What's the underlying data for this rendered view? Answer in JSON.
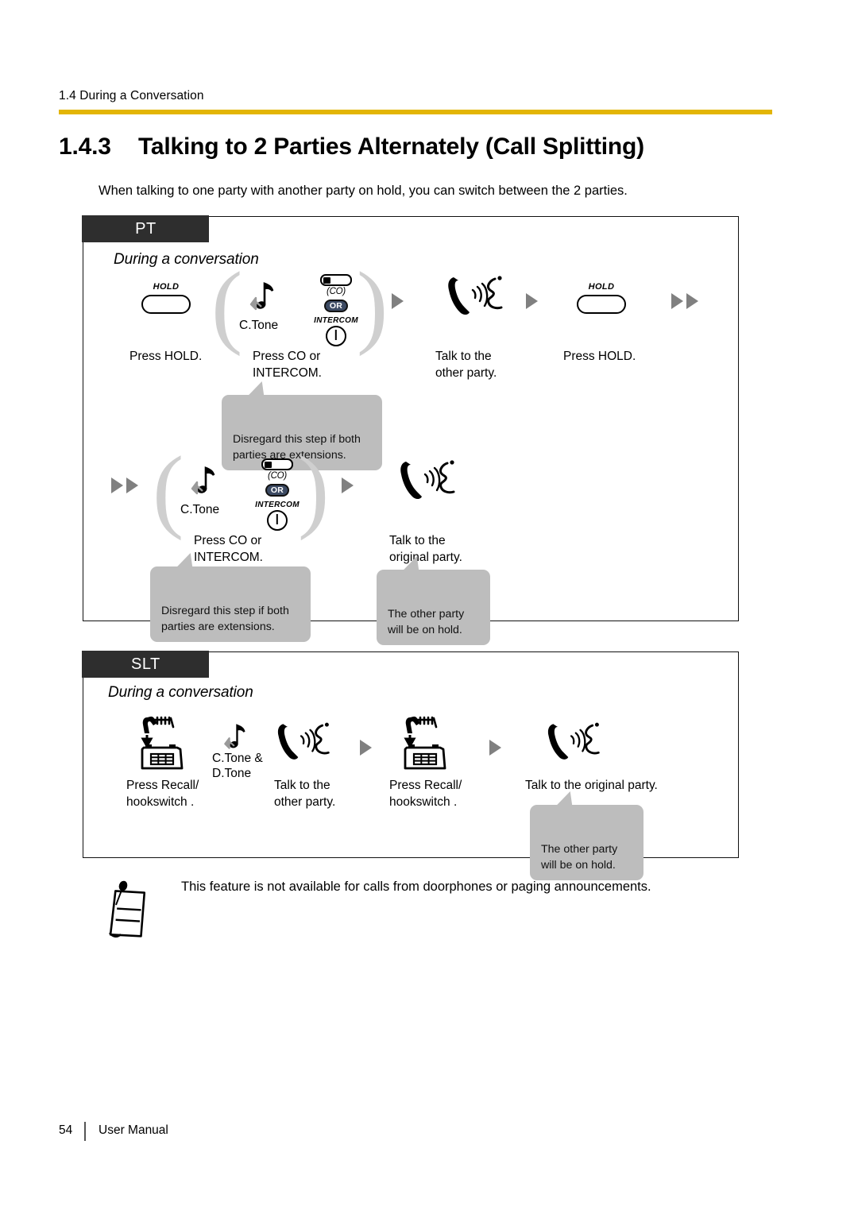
{
  "header": {
    "running_head": "1.4 During a Conversation",
    "rule_color": "#e3b505"
  },
  "section": {
    "number": "1.4.3",
    "title": "Talking to 2 Parties Alternately (Call Splitting)",
    "intro": "When talking to one party with another party on hold, you can switch between the 2 parties."
  },
  "pt_panel": {
    "tab_label": "PT",
    "subtitle": "During a conversation",
    "row1": {
      "step1": {
        "caption": "Press HOLD.",
        "key_label": "HOLD",
        "icon": "hold-key-icon"
      },
      "step2": {
        "caption": "Press CO or\nINTERCOM.",
        "tone_label": "C.Tone",
        "co_label": "(CO)",
        "or_label": "OR",
        "intercom_label": "INTERCOM"
      },
      "step3": {
        "caption": "Talk to the\nother party.",
        "icon": "handset-talking-icon"
      },
      "step4": {
        "caption": "Press HOLD.",
        "key_label": "HOLD",
        "icon": "hold-key-icon"
      },
      "balloon": "Disregard this step if both\nparties are extensions."
    },
    "row2": {
      "step1": {
        "caption": "Press CO or\nINTERCOM.",
        "tone_label": "C.Tone",
        "co_label": "(CO)",
        "or_label": "OR",
        "intercom_label": "INTERCOM"
      },
      "step2": {
        "caption": "Talk to the\noriginal party.",
        "icon": "handset-talking-icon"
      },
      "balloon_left": "Disregard this step if both\nparties are extensions.",
      "balloon_right": "The other party\nwill be on hold."
    }
  },
  "slt_panel": {
    "tab_label": "SLT",
    "subtitle": "During a conversation",
    "step1": {
      "caption": "Press Recall/\nhookswitch  .",
      "icon": "hookswitch-icon"
    },
    "step2": {
      "tone_label": "C.Tone &\nD.Tone",
      "icon": "music-note-icon"
    },
    "step3": {
      "caption": "Talk to the\nother party.",
      "icon": "handset-talking-icon"
    },
    "step4": {
      "caption": "Press Recall/\nhookswitch  .",
      "icon": "hookswitch-icon"
    },
    "step5": {
      "caption": "Talk to the original party.",
      "icon": "handset-talking-icon"
    },
    "balloon": "The other party\nwill be on hold."
  },
  "note": {
    "icon": "notepad-pen-icon",
    "text": "This feature is not available for calls from doorphones or paging announcements."
  },
  "footer": {
    "page_number": "54",
    "label": "User Manual"
  }
}
